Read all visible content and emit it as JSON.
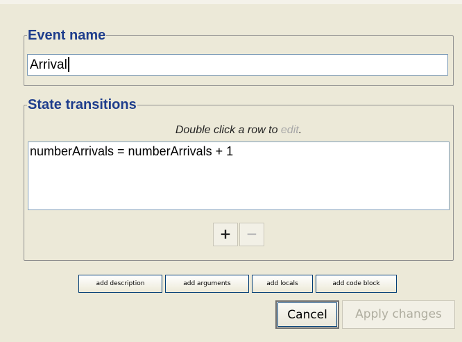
{
  "event_name_group": {
    "legend": "Event name",
    "value": "Arrival"
  },
  "state_transitions_group": {
    "legend": "State transitions",
    "hint_prefix": "Double click a row to ",
    "hint_edit": "edit",
    "hint_suffix": ".",
    "rows": [
      "numberArrivals = numberArrivals + 1"
    ],
    "add_symbol": "+",
    "remove_symbol": "−"
  },
  "extra_buttons": {
    "add_description": "add description",
    "add_arguments": "add arguments",
    "add_locals": "add locals",
    "add_code_block": "add code block"
  },
  "actions": {
    "cancel": "Cancel",
    "apply": "Apply changes"
  },
  "colors": {
    "legend_text": "#1e3d8c",
    "dialog_background": "#ECE9D8",
    "disabled_text": "#b0aea0"
  }
}
